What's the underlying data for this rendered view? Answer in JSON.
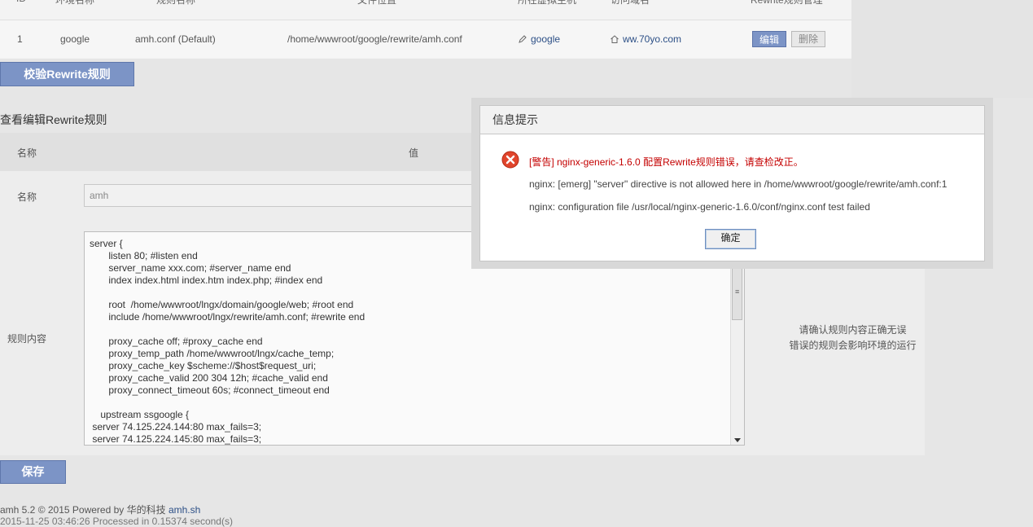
{
  "top_table": {
    "headers": [
      "ID",
      "环境名称",
      "规则名称",
      "文件位置",
      "所在虚拟主机",
      "访问域名",
      "Rewrite规则管理"
    ],
    "row": {
      "id": "1",
      "env": "google",
      "rule_name": "amh.conf  (Default)",
      "path": "/home/wwwroot/google/rewrite/amh.conf",
      "vhost": "google",
      "domain": "ww.70yo.com",
      "edit": "编辑",
      "delete": "删除"
    }
  },
  "check_button": "校验Rewrite规则",
  "section_title": "查看编辑Rewrite规则",
  "form": {
    "head_name": "名称",
    "head_value": "值",
    "name_label": "名称",
    "name_placeholder": "amh",
    "rule_label": "规则内容",
    "rule_content": "server {\n       listen 80; #listen end\n       server_name xxx.com; #server_name end\n       index index.html index.htm index.php; #index end\n\n       root  /home/wwwroot/lngx/domain/google/web; #root end\n       include /home/wwwroot/lngx/rewrite/amh.conf; #rewrite end\n\n       proxy_cache off; #proxy_cache end\n       proxy_temp_path /home/wwwroot/lngx/cache_temp;\n       proxy_cache_key $scheme://$host$request_uri;\n       proxy_cache_valid 200 304 12h; #cache_valid end\n       proxy_connect_timeout 60s; #connect_timeout end\n\n    upstream ssgoogle {\n server 74.125.224.144:80 max_fails=3;\n server 74.125.224.145:80 max_fails=3;",
    "hint_line1": "请确认规则内容正确无误",
    "hint_line2": "错误的规则会影响环境的运行"
  },
  "save_button": "保存",
  "footer": {
    "line1_prefix": "amh 5.2 © 2015 Powered by 华的科技 ",
    "line1_link": "amh.sh",
    "line2": "2015-11-25 03:46:26 Processed in 0.15374 second(s)"
  },
  "dialog": {
    "title": "信息提示",
    "message": "[警告] nginx-generic-1.6.0 配置Rewrite规则错误，请查检改正。",
    "line1": "nginx: [emerg] \"server\" directive is not allowed here in /home/wwwroot/google/rewrite/amh.conf:1",
    "line2": "nginx: configuration file /usr/local/nginx-generic-1.6.0/conf/nginx.conf test failed",
    "ok": "确定"
  },
  "colors": {
    "accent": "#7c94c6",
    "error": "#c40000",
    "link": "#2c4f86"
  }
}
